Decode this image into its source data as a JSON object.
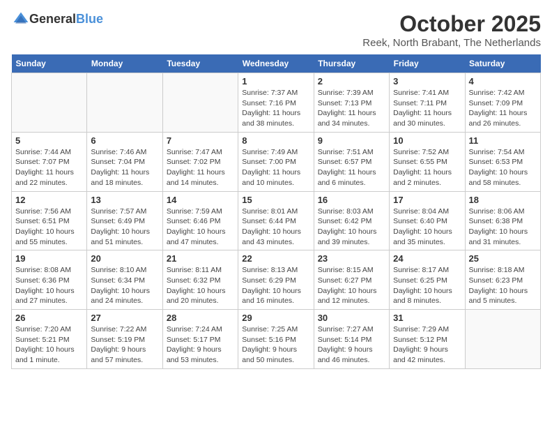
{
  "logo": {
    "general": "General",
    "blue": "Blue"
  },
  "header": {
    "month": "October 2025",
    "location": "Reek, North Brabant, The Netherlands"
  },
  "weekdays": [
    "Sunday",
    "Monday",
    "Tuesday",
    "Wednesday",
    "Thursday",
    "Friday",
    "Saturday"
  ],
  "weeks": [
    [
      {
        "day": "",
        "sunrise": "",
        "sunset": "",
        "daylight": "",
        "empty": true
      },
      {
        "day": "",
        "sunrise": "",
        "sunset": "",
        "daylight": "",
        "empty": true
      },
      {
        "day": "",
        "sunrise": "",
        "sunset": "",
        "daylight": "",
        "empty": true
      },
      {
        "day": "1",
        "sunrise": "Sunrise: 7:37 AM",
        "sunset": "Sunset: 7:16 PM",
        "daylight": "Daylight: 11 hours and 38 minutes."
      },
      {
        "day": "2",
        "sunrise": "Sunrise: 7:39 AM",
        "sunset": "Sunset: 7:13 PM",
        "daylight": "Daylight: 11 hours and 34 minutes."
      },
      {
        "day": "3",
        "sunrise": "Sunrise: 7:41 AM",
        "sunset": "Sunset: 7:11 PM",
        "daylight": "Daylight: 11 hours and 30 minutes."
      },
      {
        "day": "4",
        "sunrise": "Sunrise: 7:42 AM",
        "sunset": "Sunset: 7:09 PM",
        "daylight": "Daylight: 11 hours and 26 minutes."
      }
    ],
    [
      {
        "day": "5",
        "sunrise": "Sunrise: 7:44 AM",
        "sunset": "Sunset: 7:07 PM",
        "daylight": "Daylight: 11 hours and 22 minutes."
      },
      {
        "day": "6",
        "sunrise": "Sunrise: 7:46 AM",
        "sunset": "Sunset: 7:04 PM",
        "daylight": "Daylight: 11 hours and 18 minutes."
      },
      {
        "day": "7",
        "sunrise": "Sunrise: 7:47 AM",
        "sunset": "Sunset: 7:02 PM",
        "daylight": "Daylight: 11 hours and 14 minutes."
      },
      {
        "day": "8",
        "sunrise": "Sunrise: 7:49 AM",
        "sunset": "Sunset: 7:00 PM",
        "daylight": "Daylight: 11 hours and 10 minutes."
      },
      {
        "day": "9",
        "sunrise": "Sunrise: 7:51 AM",
        "sunset": "Sunset: 6:57 PM",
        "daylight": "Daylight: 11 hours and 6 minutes."
      },
      {
        "day": "10",
        "sunrise": "Sunrise: 7:52 AM",
        "sunset": "Sunset: 6:55 PM",
        "daylight": "Daylight: 11 hours and 2 minutes."
      },
      {
        "day": "11",
        "sunrise": "Sunrise: 7:54 AM",
        "sunset": "Sunset: 6:53 PM",
        "daylight": "Daylight: 10 hours and 58 minutes."
      }
    ],
    [
      {
        "day": "12",
        "sunrise": "Sunrise: 7:56 AM",
        "sunset": "Sunset: 6:51 PM",
        "daylight": "Daylight: 10 hours and 55 minutes."
      },
      {
        "day": "13",
        "sunrise": "Sunrise: 7:57 AM",
        "sunset": "Sunset: 6:49 PM",
        "daylight": "Daylight: 10 hours and 51 minutes."
      },
      {
        "day": "14",
        "sunrise": "Sunrise: 7:59 AM",
        "sunset": "Sunset: 6:46 PM",
        "daylight": "Daylight: 10 hours and 47 minutes."
      },
      {
        "day": "15",
        "sunrise": "Sunrise: 8:01 AM",
        "sunset": "Sunset: 6:44 PM",
        "daylight": "Daylight: 10 hours and 43 minutes."
      },
      {
        "day": "16",
        "sunrise": "Sunrise: 8:03 AM",
        "sunset": "Sunset: 6:42 PM",
        "daylight": "Daylight: 10 hours and 39 minutes."
      },
      {
        "day": "17",
        "sunrise": "Sunrise: 8:04 AM",
        "sunset": "Sunset: 6:40 PM",
        "daylight": "Daylight: 10 hours and 35 minutes."
      },
      {
        "day": "18",
        "sunrise": "Sunrise: 8:06 AM",
        "sunset": "Sunset: 6:38 PM",
        "daylight": "Daylight: 10 hours and 31 minutes."
      }
    ],
    [
      {
        "day": "19",
        "sunrise": "Sunrise: 8:08 AM",
        "sunset": "Sunset: 6:36 PM",
        "daylight": "Daylight: 10 hours and 27 minutes."
      },
      {
        "day": "20",
        "sunrise": "Sunrise: 8:10 AM",
        "sunset": "Sunset: 6:34 PM",
        "daylight": "Daylight: 10 hours and 24 minutes."
      },
      {
        "day": "21",
        "sunrise": "Sunrise: 8:11 AM",
        "sunset": "Sunset: 6:32 PM",
        "daylight": "Daylight: 10 hours and 20 minutes."
      },
      {
        "day": "22",
        "sunrise": "Sunrise: 8:13 AM",
        "sunset": "Sunset: 6:29 PM",
        "daylight": "Daylight: 10 hours and 16 minutes."
      },
      {
        "day": "23",
        "sunrise": "Sunrise: 8:15 AM",
        "sunset": "Sunset: 6:27 PM",
        "daylight": "Daylight: 10 hours and 12 minutes."
      },
      {
        "day": "24",
        "sunrise": "Sunrise: 8:17 AM",
        "sunset": "Sunset: 6:25 PM",
        "daylight": "Daylight: 10 hours and 8 minutes."
      },
      {
        "day": "25",
        "sunrise": "Sunrise: 8:18 AM",
        "sunset": "Sunset: 6:23 PM",
        "daylight": "Daylight: 10 hours and 5 minutes."
      }
    ],
    [
      {
        "day": "26",
        "sunrise": "Sunrise: 7:20 AM",
        "sunset": "Sunset: 5:21 PM",
        "daylight": "Daylight: 10 hours and 1 minute."
      },
      {
        "day": "27",
        "sunrise": "Sunrise: 7:22 AM",
        "sunset": "Sunset: 5:19 PM",
        "daylight": "Daylight: 9 hours and 57 minutes."
      },
      {
        "day": "28",
        "sunrise": "Sunrise: 7:24 AM",
        "sunset": "Sunset: 5:17 PM",
        "daylight": "Daylight: 9 hours and 53 minutes."
      },
      {
        "day": "29",
        "sunrise": "Sunrise: 7:25 AM",
        "sunset": "Sunset: 5:16 PM",
        "daylight": "Daylight: 9 hours and 50 minutes."
      },
      {
        "day": "30",
        "sunrise": "Sunrise: 7:27 AM",
        "sunset": "Sunset: 5:14 PM",
        "daylight": "Daylight: 9 hours and 46 minutes."
      },
      {
        "day": "31",
        "sunrise": "Sunrise: 7:29 AM",
        "sunset": "Sunset: 5:12 PM",
        "daylight": "Daylight: 9 hours and 42 minutes."
      },
      {
        "day": "",
        "sunrise": "",
        "sunset": "",
        "daylight": "",
        "empty": true
      }
    ]
  ]
}
